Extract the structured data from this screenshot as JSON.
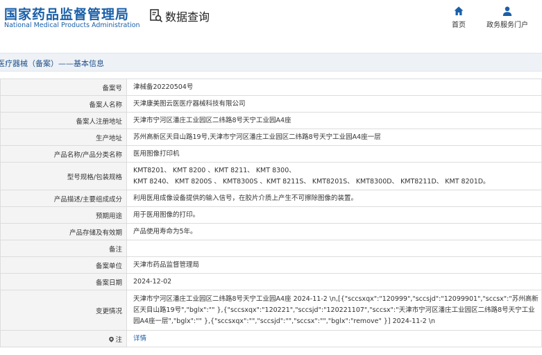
{
  "header": {
    "logo_cn": "国家药品监督管理局",
    "logo_en": "National Medical Products Administration",
    "query_label": "数据查询",
    "nav": [
      {
        "label": "首页",
        "icon": "home-icon"
      },
      {
        "label": "政务服务门户",
        "icon": "user-icon"
      }
    ]
  },
  "breadcrumb": "医疗器械（备案）——基本信息",
  "colors": {
    "brand": "#1a5fa8",
    "title_bar": "#eef2f6",
    "key_cell": "#f4f4f4"
  },
  "record": {
    "filing_no": {
      "label": "备案号",
      "value": "津械备20220504号"
    },
    "filer_name": {
      "label": "备案人名称",
      "value": "天津康美图云医医疗器械科技有限公司"
    },
    "filer_address": {
      "label": "备案人注册地址",
      "value": "天津市宁河区潘庄工业园区二纬路8号天宁工业园A4座"
    },
    "production_address": {
      "label": "生产地址",
      "value": "苏州高新区天目山路19号,天津市宁河区潘庄工业园区二纬路8号天宁工业园A4座一层"
    },
    "product_name": {
      "label": "产品名称/产品分类名称",
      "value": "医用图像打印机"
    },
    "model_spec": {
      "label": "型号规格/包装规格",
      "line1": "KMT8201、 KMT 8200 、KMT 8211、 KMT 8300、",
      "line2": "KMT 8240、 KMT 8200S 、 KMT8300S 、KMT 8211S、 KMT8201S、 KMT8300D、 KMT8211D、 KMT 8201D。"
    },
    "description": {
      "label": "产品描述/主要组成成分",
      "value": "利用医用成像设备提供的输入信号，在胶片介质上产生不可擦除图像的装置。"
    },
    "intended_use": {
      "label": "预期用途",
      "value": "用于医用图像的打印。"
    },
    "storage": {
      "label": "产品存储及有效期",
      "value": "产品使用寿命为5年。"
    },
    "remarks": {
      "label": "备注",
      "value": ""
    },
    "filing_unit": {
      "label": "备案单位",
      "value": "天津市药品监督管理局"
    },
    "filing_date": {
      "label": "备案日期",
      "value": "2024-12-02"
    },
    "change_history": {
      "label": "变更情况",
      "value": "天津市宁河区潘庄工业园区二纬路8号天宁工业园A4座 2024-11-2 \\n,[{\"sccsxqx\":\"120999\",\"sccsjd\":\"12099901\",\"sccsx\":\"苏州高新区天目山路19号\",\"bglx\":\"\" },{\"sccsxqx\":\"120221\",\"sccsjd\":\"120221107\",\"sccsx\":\"天津市宁河区潘庄工业园区二纬路8号天宁工业园A4座一层\",\"bglx\":\"\" },{\"sccsxqx\":\"\",\"sccsjd\":\"\",\"sccsx\":\"\",\"bglx\":\"remove\" }] 2024-11-2 \\n"
    },
    "note": {
      "label": "注",
      "link": "详情",
      "icon": "note-icon"
    }
  }
}
